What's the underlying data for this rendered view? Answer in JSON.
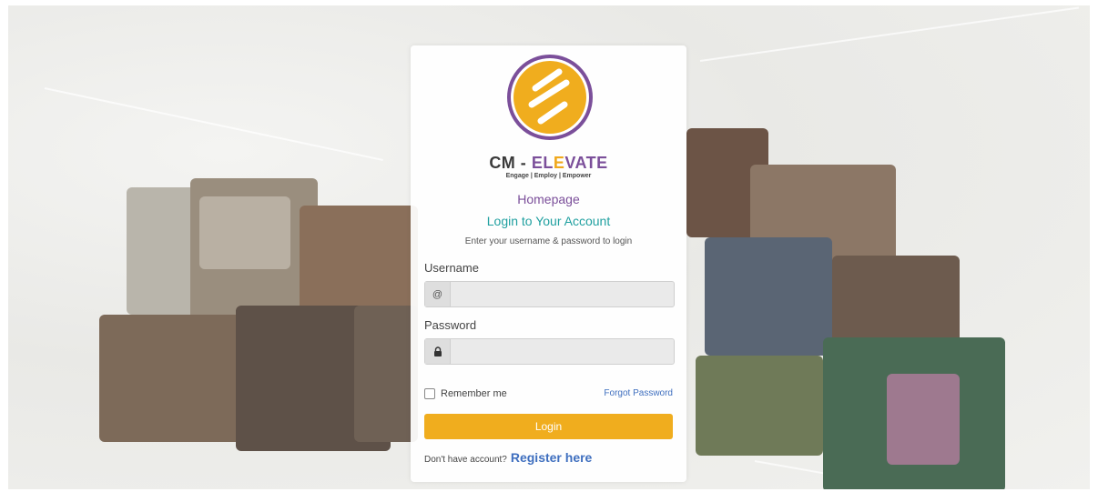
{
  "login_card": {
    "brand": {
      "prefix": "CM - ",
      "accent": "EL",
      "e_mark": "E",
      "suffix": "VATE"
    },
    "tagline": "Engage | Employ | Empower",
    "page_name": "Homepage",
    "title": "Login to Your Account",
    "subtitle": "Enter your username & password to login",
    "username": {
      "label": "Username",
      "addon": "@",
      "value": "",
      "placeholder": ""
    },
    "password": {
      "label": "Password",
      "value": "",
      "placeholder": ""
    },
    "remember_label": "Remember me",
    "forgot_label": "Forgot Password",
    "login_label": "Login",
    "register_prompt": "Don't have account?",
    "register_link": "Register here"
  },
  "colors": {
    "primary_orange": "#f0ad1e",
    "brand_purple": "#7b4f9a",
    "title_teal": "#20a0a0",
    "link_blue": "#3f6fbf"
  },
  "icons": {
    "lock": "lock-icon",
    "logo": "cm-elevate-logo"
  }
}
